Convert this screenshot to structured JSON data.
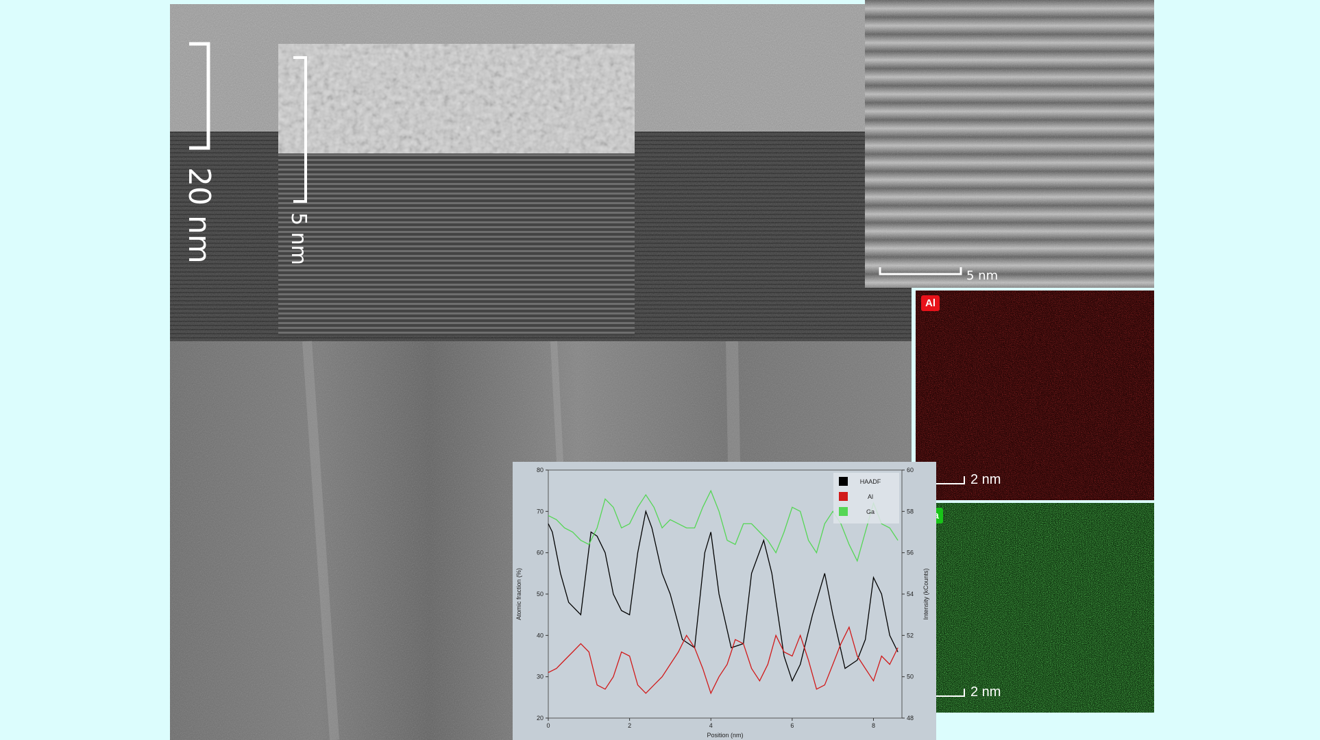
{
  "images": {
    "overview_scale": "20 nm",
    "inset_scale": "5 nm",
    "haadf_scale": "5 nm",
    "map_scale": "2 nm"
  },
  "maps": [
    {
      "element": "Al",
      "color": "#e8121a"
    },
    {
      "element": "Ga",
      "color": "#18c418"
    }
  ],
  "chart_data": {
    "type": "line",
    "xlabel": "Position (nm)",
    "ylabel_left": "Atomic fraction (%)",
    "ylabel_right": "Intensity (kCounts)",
    "xlim": [
      0,
      8.7
    ],
    "ylim_left": [
      20,
      80
    ],
    "ylim_right": [
      48,
      60
    ],
    "x_ticks": [
      0,
      2,
      4,
      6,
      8
    ],
    "y_ticks_left": [
      20,
      30,
      40,
      50,
      60,
      70,
      80
    ],
    "y_ticks_right": [
      48,
      50,
      52,
      54,
      56,
      58,
      60
    ],
    "legend_position": "top-right",
    "series": [
      {
        "name": "HAADF",
        "axis": "right",
        "color": "#000000",
        "x": [
          0,
          0.1,
          0.3,
          0.5,
          0.8,
          1.05,
          1.2,
          1.4,
          1.6,
          1.8,
          2.0,
          2.2,
          2.4,
          2.55,
          2.8,
          3.0,
          3.3,
          3.6,
          3.85,
          4.0,
          4.2,
          4.5,
          4.8,
          5.0,
          5.3,
          5.5,
          5.8,
          6.0,
          6.2,
          6.5,
          6.8,
          7.0,
          7.3,
          7.6,
          7.8,
          8.0,
          8.2,
          8.4,
          8.6
        ],
        "y": [
          57.4,
          57.0,
          55.0,
          53.6,
          53.0,
          57.0,
          56.8,
          56.0,
          54.0,
          53.2,
          53.0,
          56.0,
          58.0,
          57.2,
          55.0,
          54.0,
          51.8,
          51.4,
          56.0,
          57.0,
          54.0,
          51.4,
          51.6,
          55.0,
          56.6,
          55.0,
          51.0,
          49.8,
          50.6,
          53.0,
          55.0,
          53.0,
          50.4,
          50.8,
          51.8,
          54.8,
          54.0,
          52.0,
          51.2
        ]
      },
      {
        "name": "Al",
        "axis": "left",
        "color": "#d11919",
        "x": [
          0,
          0.2,
          0.4,
          0.6,
          0.8,
          1.0,
          1.2,
          1.4,
          1.6,
          1.8,
          2.0,
          2.2,
          2.4,
          2.6,
          2.8,
          3.0,
          3.2,
          3.4,
          3.6,
          3.8,
          4.0,
          4.2,
          4.4,
          4.6,
          4.8,
          5.0,
          5.2,
          5.4,
          5.6,
          5.8,
          6.0,
          6.2,
          6.4,
          6.6,
          6.8,
          7.0,
          7.2,
          7.4,
          7.6,
          7.8,
          8.0,
          8.2,
          8.4,
          8.6
        ],
        "y": [
          31,
          32,
          34,
          36,
          38,
          36,
          28,
          27,
          30,
          36,
          35,
          28,
          26,
          28,
          30,
          33,
          36,
          40,
          37,
          32,
          26,
          30,
          33,
          39,
          38,
          32,
          29,
          33,
          40,
          36,
          35,
          40,
          34,
          27,
          28,
          33,
          38,
          42,
          35,
          32,
          29,
          35,
          33,
          37
        ]
      },
      {
        "name": "Ga",
        "axis": "left",
        "color": "#55d655",
        "x": [
          0,
          0.2,
          0.4,
          0.6,
          0.8,
          1.0,
          1.2,
          1.4,
          1.6,
          1.8,
          2.0,
          2.2,
          2.4,
          2.6,
          2.8,
          3.0,
          3.2,
          3.4,
          3.6,
          3.8,
          4.0,
          4.2,
          4.4,
          4.6,
          4.8,
          5.0,
          5.2,
          5.4,
          5.6,
          5.8,
          6.0,
          6.2,
          6.4,
          6.6,
          6.8,
          7.0,
          7.2,
          7.4,
          7.6,
          7.8,
          8.0,
          8.2,
          8.4,
          8.6
        ],
        "y": [
          69,
          68,
          66,
          65,
          63,
          62,
          66,
          73,
          71,
          66,
          67,
          71,
          74,
          71,
          66,
          68,
          67,
          66,
          66,
          71,
          75,
          70,
          63,
          62,
          67,
          67,
          65,
          63,
          60,
          65,
          71,
          70,
          63,
          60,
          67,
          70,
          67,
          62,
          58,
          65,
          72,
          67,
          66,
          63
        ]
      }
    ]
  }
}
